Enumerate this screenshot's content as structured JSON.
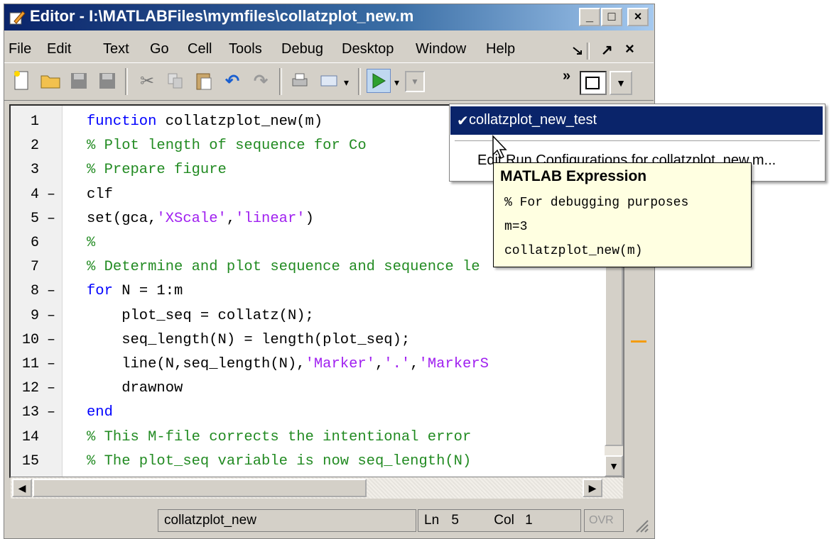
{
  "window": {
    "title": "Editor - I:\\MATLABFiles\\mymfiles\\collatzplot_new.m",
    "minimize": "_",
    "maximize": "□",
    "close": "×"
  },
  "menu": {
    "items": [
      "File",
      "Edit",
      "Text",
      "Go",
      "Cell",
      "Tools",
      "Debug",
      "Desktop",
      "Window",
      "Help"
    ],
    "dock_icon": "undock-arrow-icon",
    "right_arrow": "↗",
    "close": "×"
  },
  "toolbar": {
    "icons": [
      "new-file-icon",
      "open-folder-icon",
      "save-icon",
      "save-all-icon",
      "cut-icon",
      "copy-icon",
      "paste-icon",
      "undo-icon",
      "redo-icon",
      "print-icon",
      "find-icon",
      "run-icon"
    ],
    "overflow": "»"
  },
  "editor": {
    "lines": [
      {
        "n": "1",
        "dash": "",
        "code": [
          {
            "t": "function ",
            "c": "kw"
          },
          {
            "t": "collatzplot_new(m)",
            "c": "tx"
          }
        ]
      },
      {
        "n": "2",
        "dash": "",
        "code": [
          {
            "t": "% Plot length of sequence for Co",
            "c": "cm"
          }
        ]
      },
      {
        "n": "3",
        "dash": "",
        "code": [
          {
            "t": "% Prepare figure",
            "c": "cm"
          }
        ]
      },
      {
        "n": "4",
        "dash": "–",
        "code": [
          {
            "t": "clf",
            "c": "tx"
          }
        ]
      },
      {
        "n": "5",
        "dash": "–",
        "code": [
          {
            "t": "set(gca,",
            "c": "tx"
          },
          {
            "t": "'XScale'",
            "c": "st"
          },
          {
            "t": ",",
            "c": "tx"
          },
          {
            "t": "'linear'",
            "c": "st"
          },
          {
            "t": ")",
            "c": "tx"
          }
        ]
      },
      {
        "n": "6",
        "dash": "",
        "code": [
          {
            "t": "%",
            "c": "cm"
          }
        ]
      },
      {
        "n": "7",
        "dash": "",
        "code": [
          {
            "t": "% Determine and plot sequence and sequence le",
            "c": "cm"
          }
        ]
      },
      {
        "n": "8",
        "dash": "–",
        "code": [
          {
            "t": "for ",
            "c": "kw"
          },
          {
            "t": "N = 1:m",
            "c": "tx"
          }
        ]
      },
      {
        "n": "9",
        "dash": "–",
        "code": [
          {
            "t": "    plot_seq = collatz(N);",
            "c": "tx"
          }
        ]
      },
      {
        "n": "10",
        "dash": "–",
        "code": [
          {
            "t": "    seq_length(N) = length(plot_seq);",
            "c": "tx"
          }
        ]
      },
      {
        "n": "11",
        "dash": "–",
        "code": [
          {
            "t": "    line(N,seq_length(N),",
            "c": "tx"
          },
          {
            "t": "'Marker'",
            "c": "st"
          },
          {
            "t": ",",
            "c": "tx"
          },
          {
            "t": "'.'",
            "c": "st"
          },
          {
            "t": ",",
            "c": "tx"
          },
          {
            "t": "'MarkerS",
            "c": "st"
          }
        ]
      },
      {
        "n": "12",
        "dash": "–",
        "code": [
          {
            "t": "    drawnow",
            "c": "tx"
          }
        ]
      },
      {
        "n": "13",
        "dash": "–",
        "code": [
          {
            "t": "end",
            "c": "kw"
          }
        ]
      },
      {
        "n": "14",
        "dash": "",
        "code": [
          {
            "t": "% This M-file corrects the intentional error",
            "c": "cm"
          }
        ]
      },
      {
        "n": "15",
        "dash": "",
        "code": [
          {
            "t": "% The plot_seq variable is now seq_length(N)",
            "c": "cm"
          }
        ]
      }
    ]
  },
  "statusbar": {
    "function_name": "collatzplot_new",
    "ln_label": "Ln",
    "ln_value": "5",
    "col_label": "Col",
    "col_value": "1",
    "ovr": "OVR"
  },
  "run_dropdown": {
    "selected": "collatzplot_new_test",
    "edit_label": "Edit Run Configurations for collatzplot_new.m..."
  },
  "tooltip": {
    "title": "MATLAB Expression",
    "lines": [
      "% For debugging purposes",
      "m=3",
      "collatzplot_new(m)"
    ]
  },
  "colors": {
    "keyword": "#0000ff",
    "comment": "#228b22",
    "string": "#a020f0",
    "selection": "#0a246a",
    "tooltip_bg": "#ffffe1"
  }
}
